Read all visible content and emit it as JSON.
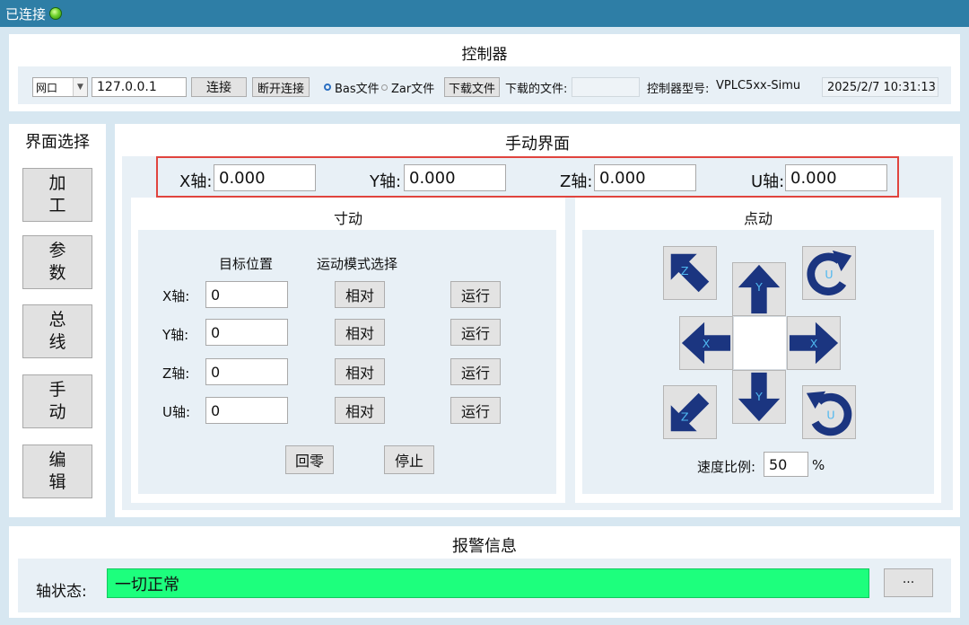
{
  "titlebar": {
    "status": "已连接"
  },
  "controller": {
    "title": "控制器",
    "port_type": "网口",
    "ip": "127.0.0.1",
    "connect_label": "连接",
    "disconnect_label": "断开连接",
    "radio_bas": "Bas文件",
    "radio_zar": "Zar文件",
    "download_label": "下载文件",
    "downloaded_file_label": "下载的文件:",
    "downloaded_file_value": "",
    "model_label": "控制器型号:",
    "model_value": "VPLC5xx-Simu",
    "datetime": "2025/2/7 10:31:13"
  },
  "sidebar": {
    "title": "界面选择",
    "items": [
      {
        "label": "加工"
      },
      {
        "label": "参数"
      },
      {
        "label": "总线"
      },
      {
        "label": "手动"
      },
      {
        "label": "编辑"
      }
    ]
  },
  "manual": {
    "title": "手动界面",
    "positions": [
      {
        "label": "X轴:",
        "value": "0.000"
      },
      {
        "label": "Y轴:",
        "value": "0.000"
      },
      {
        "label": "Z轴:",
        "value": "0.000"
      },
      {
        "label": "U轴:",
        "value": "0.000"
      }
    ],
    "inch": {
      "title": "寸动",
      "target_header": "目标位置",
      "mode_header": "运动模式选择",
      "rows": [
        {
          "label": "X轴:",
          "value": "0",
          "mode": "相对",
          "run": "运行"
        },
        {
          "label": "Y轴:",
          "value": "0",
          "mode": "相对",
          "run": "运行"
        },
        {
          "label": "Z轴:",
          "value": "0",
          "mode": "相对",
          "run": "运行"
        },
        {
          "label": "U轴:",
          "value": "0",
          "mode": "相对",
          "run": "运行"
        }
      ],
      "home_label": "回零",
      "stop_label": "停止"
    },
    "jog": {
      "title": "点动",
      "speed_label": "速度比例:",
      "speed_value": "50",
      "speed_unit": "%",
      "labels": {
        "x": "X",
        "y": "Y",
        "z": "Z",
        "u": "U"
      }
    }
  },
  "alarm": {
    "title": "报警信息",
    "axis_status_label": "轴状态:",
    "axis_status_value": "一切正常",
    "more_label": "···"
  },
  "colors": {
    "titlebar": "#2e7ea6",
    "arrow": "#1b3580",
    "arrow_letter": "#4fb8f0",
    "highlight": "#e0443e",
    "status_ok": "#1dff7d"
  }
}
